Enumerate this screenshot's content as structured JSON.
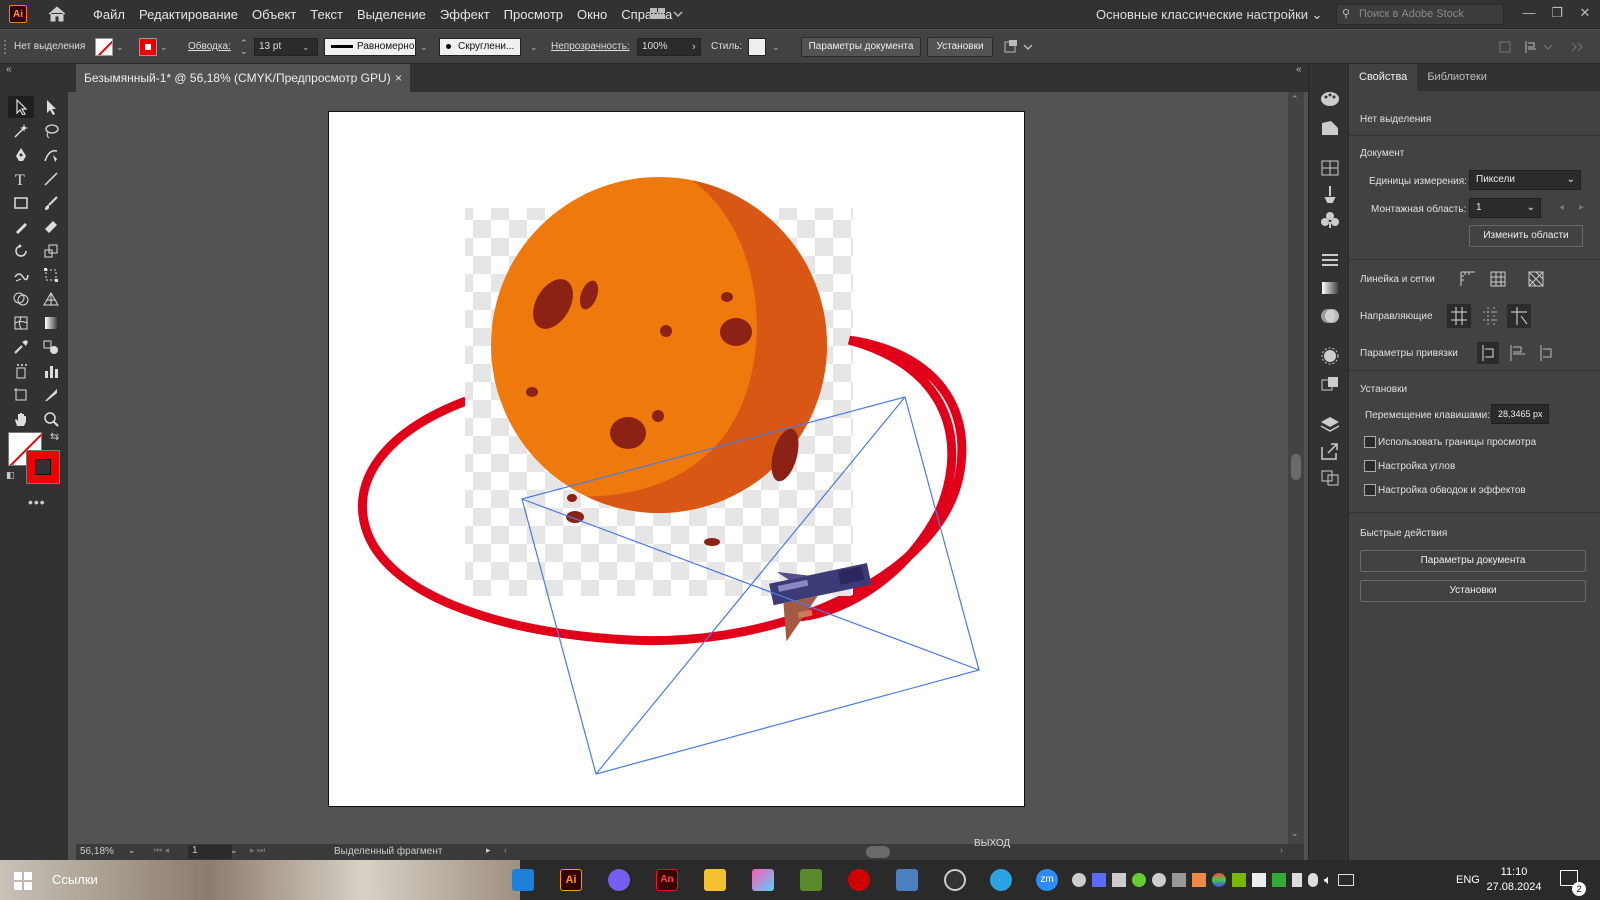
{
  "app": {
    "logo": "Ai"
  },
  "menu": [
    "Файл",
    "Редактирование",
    "Объект",
    "Текст",
    "Выделение",
    "Эффект",
    "Просмотр",
    "Окно",
    "Справка"
  ],
  "workspace": "Основные классические настройки",
  "stock_placeholder": "Поиск в Adobe Stock",
  "control": {
    "no_selection": "Нет выделения",
    "stroke_label": "Обводка:",
    "stroke_value": "13 pt",
    "profile": "Равномерно",
    "brush": "Скруглени...",
    "opacity_label": "Непрозрачность:",
    "opacity_value": "100%",
    "style_label": "Стиль:",
    "doc_settings_btn": "Параметры документа",
    "prefs_btn": "Установки"
  },
  "doc_tab": {
    "title": "Безымянный-1* @ 56,18% (CMYK/Предпросмотр GPU)",
    "close": "×"
  },
  "status": {
    "zoom": "56,18%",
    "artboard": "1",
    "info": "Выделенный фрагмент",
    "exit": "ВЫХОД"
  },
  "panel": {
    "tabs": [
      "Свойства",
      "Библиотеки"
    ],
    "no_selection": "Нет выделения",
    "document": "Документ",
    "units_label": "Единицы измерения:",
    "units_value": "Пиксели",
    "artboard_label": "Монтажная область:",
    "artboard_value": "1",
    "edit_artboards": "Изменить области",
    "rulers": "Линейка и сетки",
    "guides": "Направляющие",
    "snap": "Параметры привязки",
    "prefs": "Установки",
    "keyboard_inc_label": "Перемещение клавишами:",
    "keyboard_inc_value": "28,3465 px",
    "checkboxes": [
      "Использовать границы просмотра",
      "Настройка углов",
      "Настройка обводок и эффектов"
    ],
    "quick_actions": "Быстрые действия",
    "qa_doc_settings": "Параметры документа",
    "qa_prefs": "Установки"
  },
  "taskbar": {
    "search": "Ссылки",
    "lang": "ENG",
    "time": "11:10",
    "date": "27.08.2024",
    "notif": "2"
  },
  "colors": {
    "orbit": "#e0001a",
    "planet": "#ee7a0e",
    "planet_shadow": "#d85714",
    "crater": "#8c2215",
    "selection": "#4b7be0"
  }
}
